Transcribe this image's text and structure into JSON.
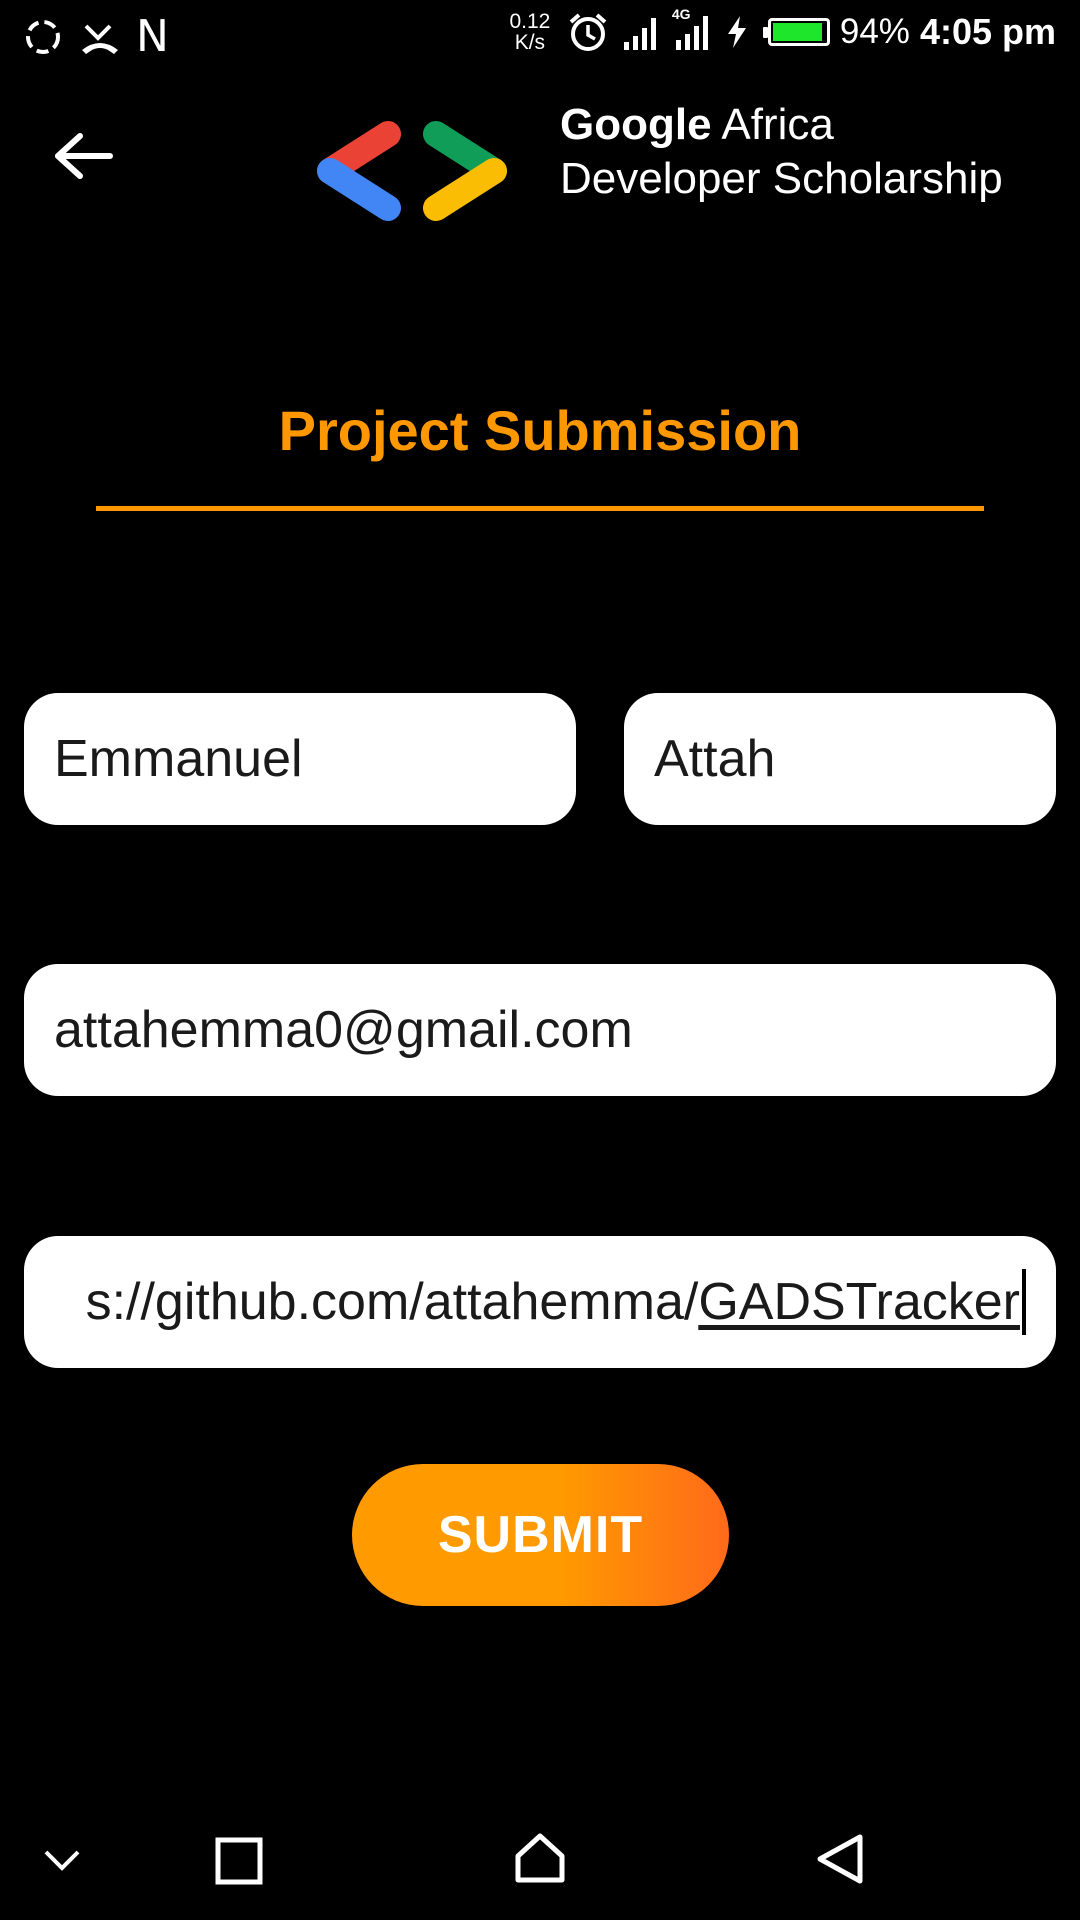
{
  "status_bar": {
    "carrier_letter": "N",
    "network_speed_value": "0.12",
    "network_speed_unit": "K/s",
    "network_type": "4G",
    "battery_percent": "94%",
    "battery_level": 0.94,
    "time": "4:05 pm",
    "battery_color": "#1ee62a"
  },
  "header": {
    "brand_line1_bold": "Google",
    "brand_line1_rest": " Africa",
    "brand_line2": "Developer Scholarship",
    "logo_colors": {
      "red": "#ea4335",
      "blue": "#4285f4",
      "green": "#0f9d58",
      "yellow": "#fbbc04"
    }
  },
  "page": {
    "title": "Project Submission",
    "accent_color": "#ff9800"
  },
  "form": {
    "first_name": "Emmanuel",
    "last_name": "Attah",
    "email": "attahemma0@gmail.com",
    "project_link_visible_prefix": "s://github.com/attahemma/",
    "project_link_visible_suffix": "GADSTracker",
    "submit_label": "SUBMIT"
  },
  "nav_bar": {
    "icons": [
      "chevron-down-icon",
      "recents-square-icon",
      "home-icon",
      "back-triangle-icon"
    ]
  }
}
